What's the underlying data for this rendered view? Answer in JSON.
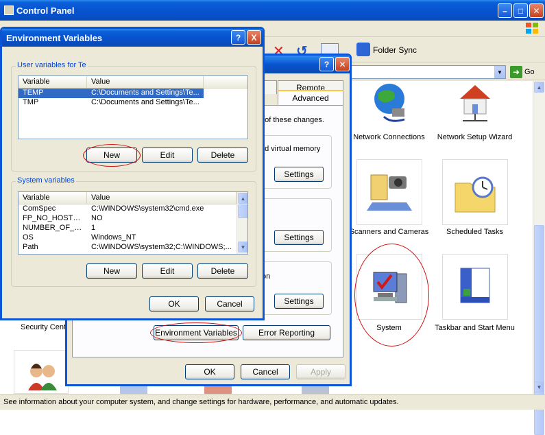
{
  "control_panel": {
    "title": "Control Panel",
    "toolbar_folder_sync": "Folder Sync",
    "go_label": "Go",
    "status_text": "See information about your computer system, and change settings for hardware, performance, and automatic updates.",
    "items": [
      {
        "label": "Network Connections"
      },
      {
        "label": "Network Setup Wizard"
      },
      {
        "label": "Scanners and Cameras"
      },
      {
        "label": "Scheduled Tasks"
      },
      {
        "label": "System"
      },
      {
        "label": "Taskbar and Start Menu"
      },
      {
        "label": "Security Cent"
      }
    ]
  },
  "system_props": {
    "tab_remote": "Remote",
    "tab_advanced": "Advanced",
    "text_changes": "t of these changes.",
    "text_virtual_memory": "nd virtual memory",
    "text_on": "on",
    "settings_1": "Settings",
    "settings_2": "Settings",
    "settings_3": "Settings",
    "env_vars_button": "Environment Variables",
    "error_reporting_button": "Error Reporting",
    "ok": "OK",
    "cancel": "Cancel",
    "apply": "Apply"
  },
  "env_dialog": {
    "title": "Environment Variables",
    "help": "?",
    "close": "X",
    "user_group_label": "User variables for Te",
    "system_group_label": "System variables",
    "col_variable": "Variable",
    "col_value": "Value",
    "user_vars": [
      {
        "name": "TEMP",
        "value": "C:\\Documents and Settings\\Te..."
      },
      {
        "name": "TMP",
        "value": "C:\\Documents and Settings\\Te..."
      }
    ],
    "system_vars": [
      {
        "name": "ComSpec",
        "value": "C:\\WINDOWS\\system32\\cmd.exe"
      },
      {
        "name": "FP_NO_HOST_C...",
        "value": "NO"
      },
      {
        "name": "NUMBER_OF_P...",
        "value": "1"
      },
      {
        "name": "OS",
        "value": "Windows_NT"
      },
      {
        "name": "Path",
        "value": "C:\\WINDOWS\\system32;C:\\WINDOWS;..."
      }
    ],
    "user_new": "New",
    "user_edit": "Edit",
    "user_delete": "Delete",
    "sys_new": "New",
    "sys_edit": "Edit",
    "sys_delete": "Delete",
    "ok": "OK",
    "cancel": "Cancel"
  }
}
